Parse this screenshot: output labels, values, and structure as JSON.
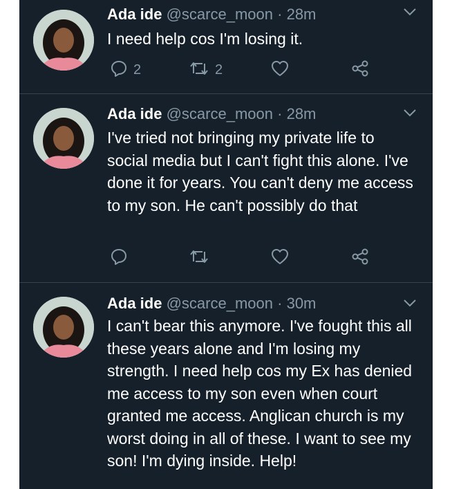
{
  "colors": {
    "background": "#15202b",
    "divider": "#38444d",
    "secondary_text": "#8899a6",
    "primary_text": "#ffffff"
  },
  "icons": [
    "chevron-down-icon",
    "reply-icon",
    "retweet-icon",
    "like-icon",
    "share-icon"
  ],
  "tweets": [
    {
      "name": "Ada ide",
      "handle": "@scarce_moon",
      "separator": "·",
      "time": "28m",
      "text": "I need help cos I'm losing it.",
      "reply_count": "2",
      "retweet_count": "2",
      "like_count": ""
    },
    {
      "name": "Ada ide",
      "handle": "@scarce_moon",
      "separator": "·",
      "time": "28m",
      "text": "I've tried not bringing my private life to social media but I can't fight this alone. I've done it for years. You can't deny me access to my son. He can't possibly do that",
      "reply_count": "",
      "retweet_count": "",
      "like_count": ""
    },
    {
      "name": "Ada ide",
      "handle": "@scarce_moon",
      "separator": "·",
      "time": "30m",
      "text": "I can't bear this anymore. I've fought this all these years alone and I'm losing my strength. I need help cos my Ex has denied me access to my son even when court granted me access. Anglican church is my worst doing in all of these. I want to see my son! I'm dying inside. Help!",
      "reply_count": "",
      "retweet_count": "",
      "like_count": ""
    }
  ]
}
